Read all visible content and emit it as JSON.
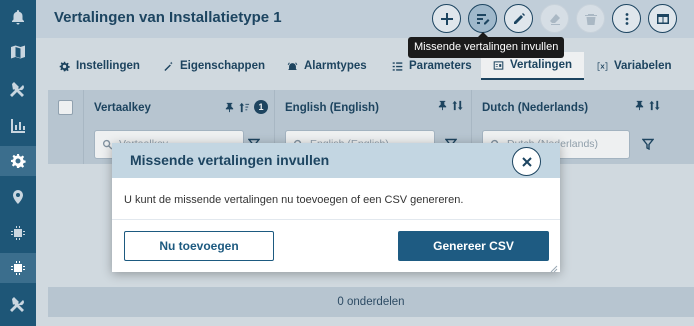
{
  "header": {
    "title": "Vertalingen van Installatietype 1",
    "buttons": [
      {
        "name": "add-button",
        "icon": "plus-icon"
      },
      {
        "name": "fill-missing-translations-button",
        "icon": "translate-edit-icon",
        "active": true
      },
      {
        "name": "edit-button",
        "icon": "pencil-icon"
      },
      {
        "name": "eraser-button",
        "icon": "eraser-icon",
        "disabled": true
      },
      {
        "name": "delete-button",
        "icon": "trash-icon",
        "disabled": true
      },
      {
        "name": "more-button",
        "icon": "dots-vertical-icon"
      },
      {
        "name": "columns-button",
        "icon": "columns-icon"
      }
    ]
  },
  "tooltip": {
    "text": "Missende vertalingen invullen"
  },
  "tabs": [
    {
      "label": "Instellingen",
      "icon": "gear-icon"
    },
    {
      "label": "Eigenschappen",
      "icon": "wand-icon"
    },
    {
      "label": "Alarmtypes",
      "icon": "alarm-icon"
    },
    {
      "label": "Parameters",
      "icon": "list-icon"
    },
    {
      "label": "Vertalingen",
      "icon": "translate-icon",
      "active": true
    },
    {
      "label": "Variabelen",
      "icon": "variable-icon"
    }
  ],
  "table": {
    "columns": [
      {
        "title": "Vertaalkey",
        "filter_placeholder": "Vertaalkey",
        "sort_badge": "1"
      },
      {
        "title": "English (English)",
        "filter_placeholder": "English (English)"
      },
      {
        "title": "Dutch (Nederlands)",
        "filter_placeholder": "Dutch (Nederlands)"
      }
    ],
    "footer": "0 onderdelen"
  },
  "modal": {
    "title": "Missende vertalingen invullen",
    "body": "U kunt de missende vertalingen nu toevoegen of een CSV genereren.",
    "secondary_button": "Nu toevoegen",
    "primary_button": "Genereer CSV"
  },
  "colors": {
    "nav_bg": "#1e5677",
    "header_bg": "#c1ced9",
    "primary": "#1e5b82",
    "tooltip_bg": "#1b1b1b"
  },
  "nav": [
    {
      "name": "nav-notifications",
      "icon": "bell-icon"
    },
    {
      "name": "nav-map",
      "icon": "map-icon"
    },
    {
      "name": "nav-tools",
      "icon": "tools-icon"
    },
    {
      "name": "nav-reports",
      "icon": "chart-icon"
    },
    {
      "name": "nav-settings",
      "icon": "gear-icon",
      "active": true
    },
    {
      "name": "nav-locations",
      "icon": "map-pin-icon"
    },
    {
      "name": "nav-devices",
      "icon": "chip-icon"
    },
    {
      "name": "nav-installation-types",
      "icon": "chip-settings-icon"
    },
    {
      "name": "nav-maintenance",
      "icon": "wrench-icon"
    }
  ]
}
